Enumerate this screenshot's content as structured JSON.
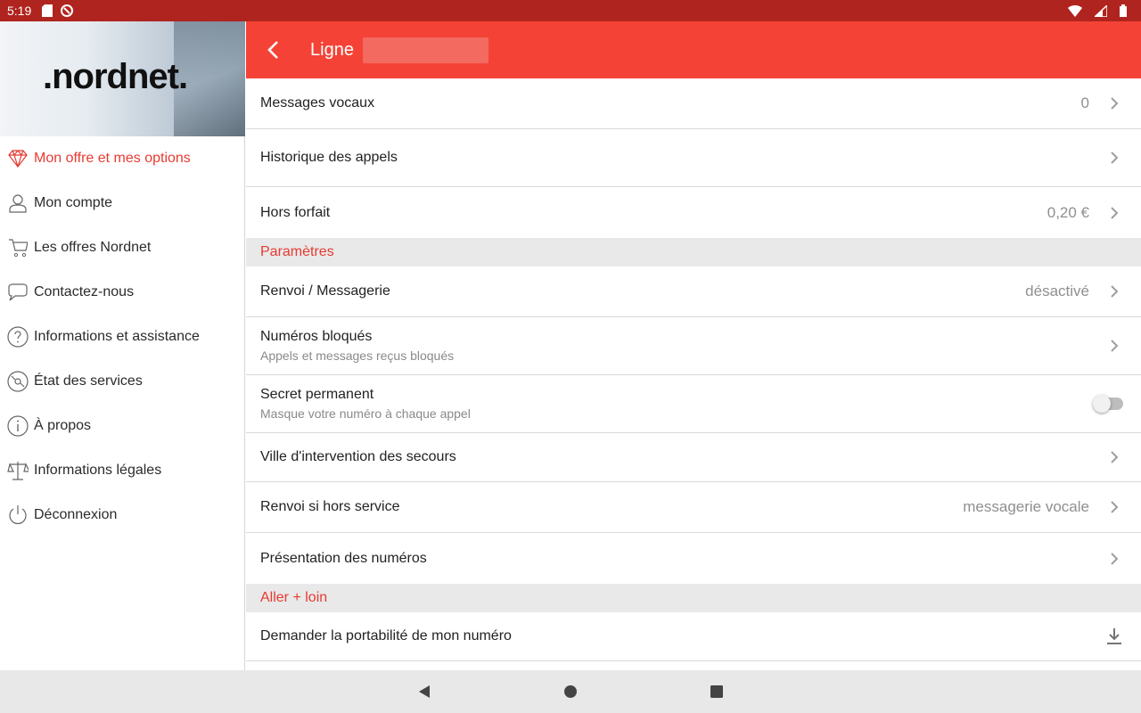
{
  "status_bar": {
    "time": "5:19",
    "left_icons": [
      "sd-card-icon",
      "sync-icon"
    ],
    "right_icons": [
      "wifi-icon",
      "signal-icon",
      "battery-icon"
    ]
  },
  "drawer": {
    "logo_text": ".nordnet.",
    "items": [
      {
        "label": "Mon offre et mes options",
        "icon": "diamond-icon",
        "active": true
      },
      {
        "label": "Mon compte",
        "icon": "user-icon",
        "active": false
      },
      {
        "label": "Les offres Nordnet",
        "icon": "cart-icon",
        "active": false
      },
      {
        "label": "Contactez-nous",
        "icon": "chat-icon",
        "active": false
      },
      {
        "label": "Informations et assistance",
        "icon": "help-icon",
        "active": false
      },
      {
        "label": "État des services",
        "icon": "service-status-icon",
        "active": false
      },
      {
        "label": "À propos",
        "icon": "info-icon",
        "active": false
      },
      {
        "label": "Informations légales",
        "icon": "scale-icon",
        "active": false
      },
      {
        "label": "Déconnexion",
        "icon": "power-icon",
        "active": false
      }
    ]
  },
  "appbar": {
    "title": "Ligne"
  },
  "rows": {
    "messages": {
      "label": "Messages vocaux",
      "value": "0"
    },
    "historique": {
      "label": "Historique des appels"
    },
    "hors_forfait": {
      "label": "Hors forfait",
      "value": "0,20 €"
    },
    "section_parametres": "Paramètres",
    "renvoi": {
      "label": "Renvoi / Messagerie",
      "value": "désactivé"
    },
    "numeros_bloques": {
      "label": "Numéros bloqués",
      "sub": "Appels et messages reçus bloqués"
    },
    "secret": {
      "label": "Secret permanent",
      "sub": "Masque votre numéro à chaque appel",
      "enabled": false
    },
    "ville": {
      "label": "Ville d'intervention des secours"
    },
    "renvoi_hs": {
      "label": "Renvoi si hors service",
      "value": "messagerie vocale"
    },
    "presentation": {
      "label": "Présentation des numéros"
    },
    "section_aller": "Aller + loin",
    "portabilite": {
      "label": "Demander la portabilité de mon numéro"
    }
  },
  "colors": {
    "accent": "#f44336",
    "status_bar": "#b0241f",
    "active_text": "#e63b32",
    "section_bg": "#e9e9e9"
  },
  "system_nav": [
    "back-icon",
    "home-icon",
    "recents-icon"
  ]
}
